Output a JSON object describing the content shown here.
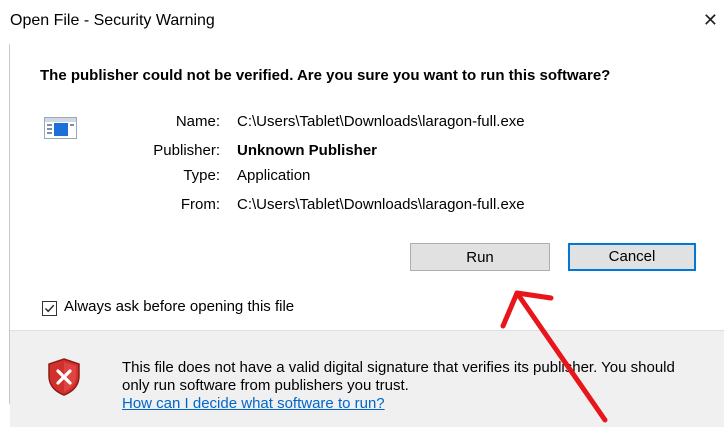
{
  "window": {
    "title": "Open File - Security Warning",
    "close_glyph": "✕"
  },
  "heading": "The publisher could not be verified.  Are you sure you want to run this software?",
  "details": {
    "name_label": "Name:",
    "name_value": "C:\\Users\\Tablet\\Downloads\\laragon-full.exe",
    "publisher_label": "Publisher:",
    "publisher_value": "Unknown Publisher",
    "type_label": "Type:",
    "type_value": "Application",
    "from_label": "From:",
    "from_value": "C:\\Users\\Tablet\\Downloads\\laragon-full.exe"
  },
  "buttons": {
    "run_label": "Run",
    "cancel_label": "Cancel"
  },
  "checkbox": {
    "label": "Always ask before opening this file",
    "checked": true
  },
  "footer": {
    "warning_text": "This file does not have a valid digital signature that verifies its publisher.  You should only run software from publishers you trust.",
    "help_link": "How can I decide what software to run?"
  },
  "icons": {
    "file": "application-file-icon",
    "shield": "security-shield-icon",
    "annotation": "red-arrow-annotation"
  },
  "colors": {
    "accent": "#0078d7",
    "link": "#0066cc",
    "shield_red": "#d0312d",
    "annotation_red": "#e8151b"
  }
}
